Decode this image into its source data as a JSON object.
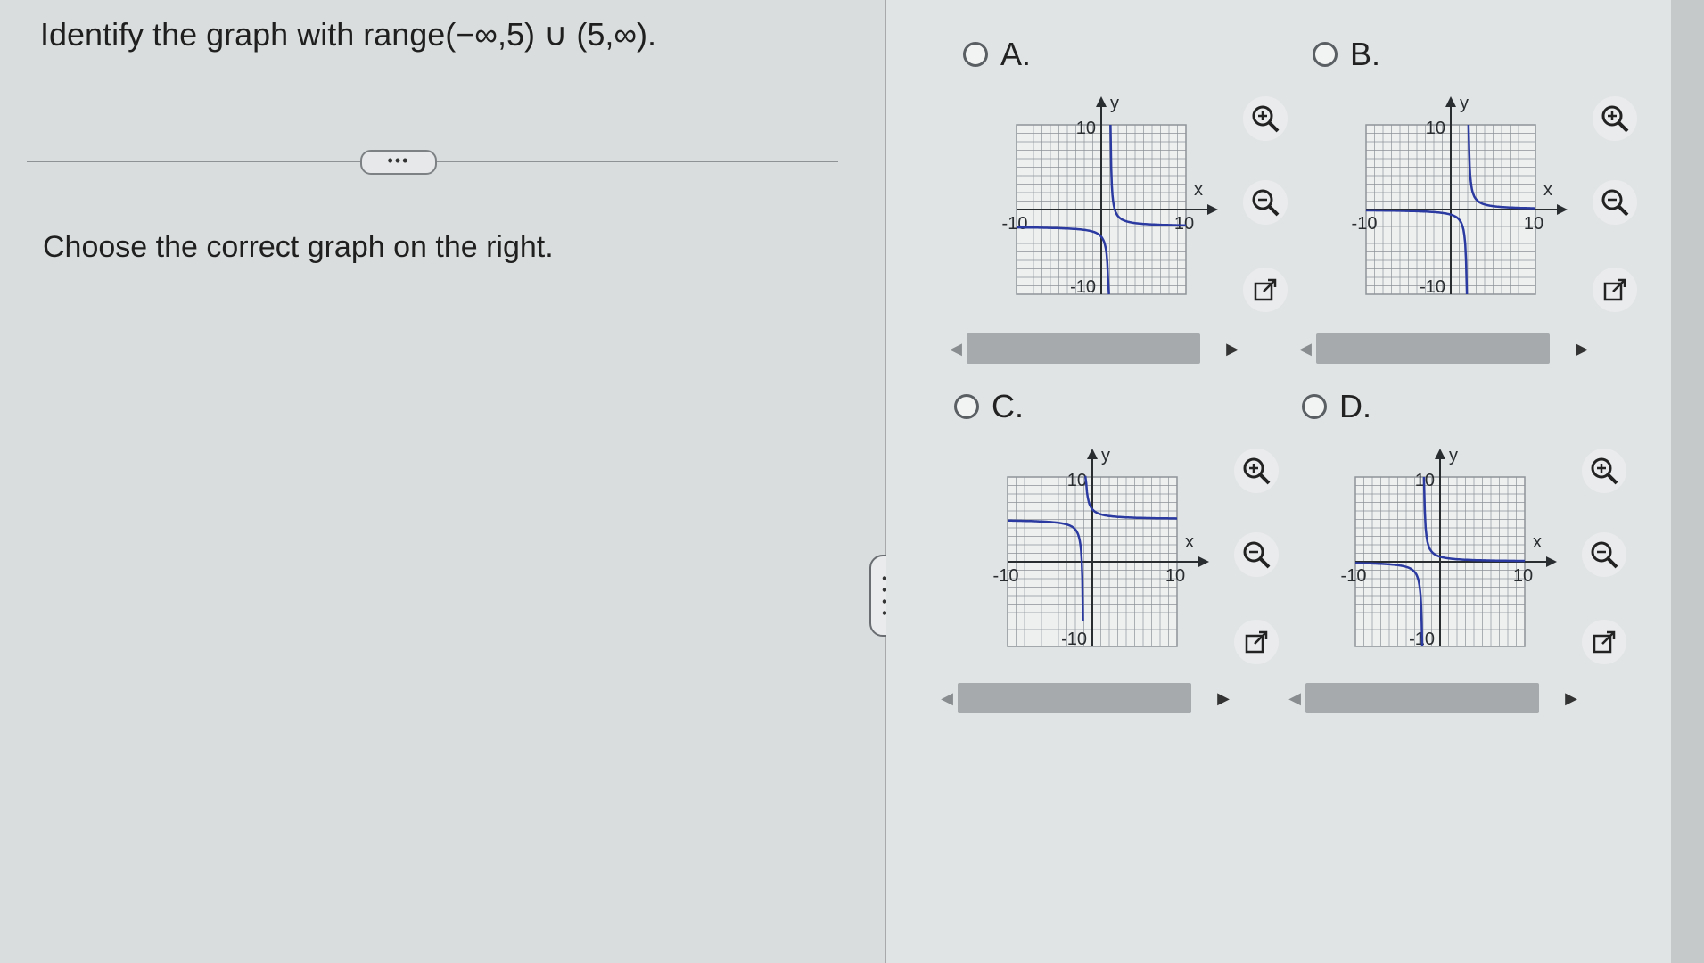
{
  "question": {
    "text": "Identify the graph with range(−∞,5) ∪ (5,∞)."
  },
  "more_button": {
    "label": "•••"
  },
  "instruction": {
    "text": "Choose the correct graph on the right."
  },
  "options": [
    {
      "id": "A",
      "label": "A."
    },
    {
      "id": "B",
      "label": "B."
    },
    {
      "id": "C",
      "label": "C."
    },
    {
      "id": "D",
      "label": "D."
    }
  ],
  "graph_labels": {
    "y_axis": "y",
    "x_axis": "x",
    "y_max": "10",
    "y_min": "-10",
    "x_min": "-10",
    "x_max": "10"
  },
  "graphs": {
    "A": {
      "x_range": [
        -10,
        10
      ],
      "y_range": [
        -10,
        10
      ],
      "vertical_asymptote_x": 1,
      "horizontal_asymptote_y": -2
    },
    "B": {
      "x_range": [
        -10,
        10
      ],
      "y_range": [
        -10,
        10
      ],
      "vertical_asymptote_x": 2,
      "horizontal_asymptote_y": 0
    },
    "C": {
      "x_range": [
        -10,
        10
      ],
      "y_range": [
        -10,
        10
      ],
      "vertical_asymptote_x": -1,
      "horizontal_asymptote_y": 5
    },
    "D": {
      "x_range": [
        -10,
        10
      ],
      "y_range": [
        -10,
        10
      ],
      "vertical_asymptote_x": -2,
      "horizontal_asymptote_y": 0
    }
  },
  "icons": {
    "zoom_in": "zoom-in-icon",
    "zoom_out": "zoom-out-icon",
    "popout": "popout-icon"
  },
  "colors": {
    "curve": "#2b3aa0",
    "grid": "#8e9399",
    "axis": "#2a2d30"
  }
}
